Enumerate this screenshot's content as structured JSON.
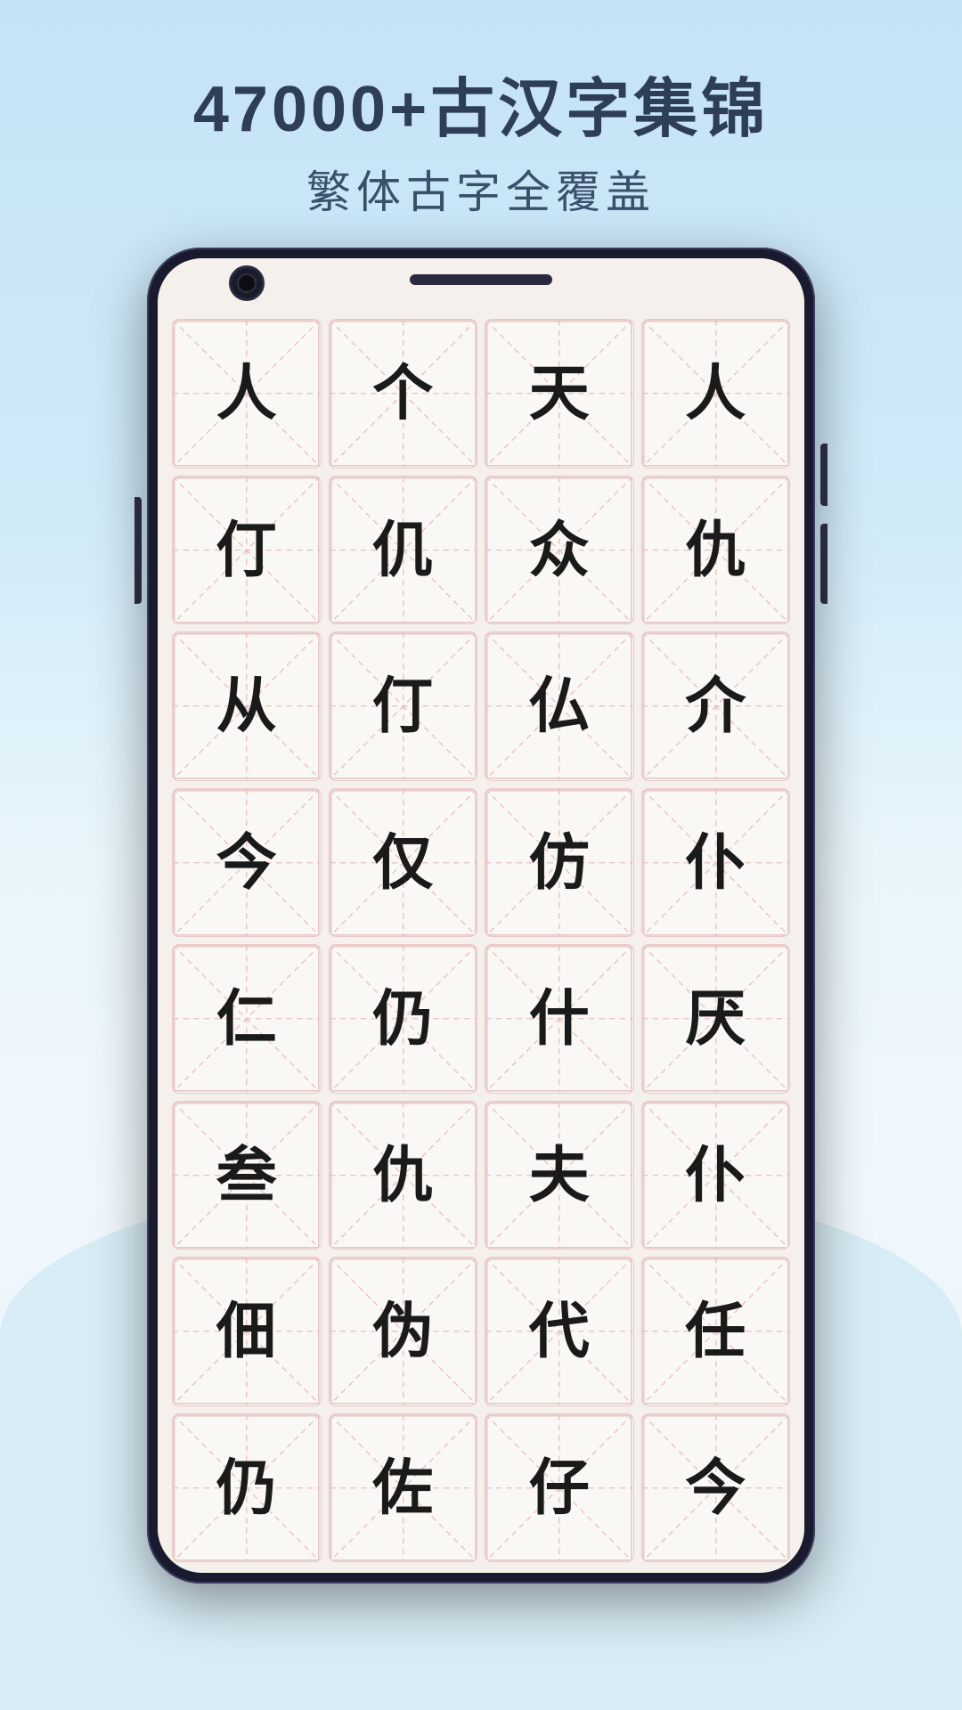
{
  "header": {
    "title": "47000+古汉字集锦",
    "subtitle": "繁体古字全覆盖"
  },
  "colors": {
    "background": "#c5e3f5",
    "text_dark": "#2d3e55",
    "text_medium": "#3a4f6a",
    "cell_border": "#e8c8c8",
    "cell_bg": "#faf8f5",
    "char_color": "#1a1a1a",
    "grid_line": "#e8c0c0"
  },
  "characters": [
    "人",
    "个",
    "天",
    "人",
    "仃",
    "仉",
    "众",
    "仇",
    "从",
    "仃",
    "仏",
    "介",
    "今",
    "仅",
    "仿",
    "仆",
    "仁",
    "仍",
    "什",
    "厌",
    "叁",
    "仇",
    "夫",
    "仆",
    "佃",
    "伪",
    "代",
    "任",
    "仍",
    "佐",
    "仔",
    "今"
  ]
}
